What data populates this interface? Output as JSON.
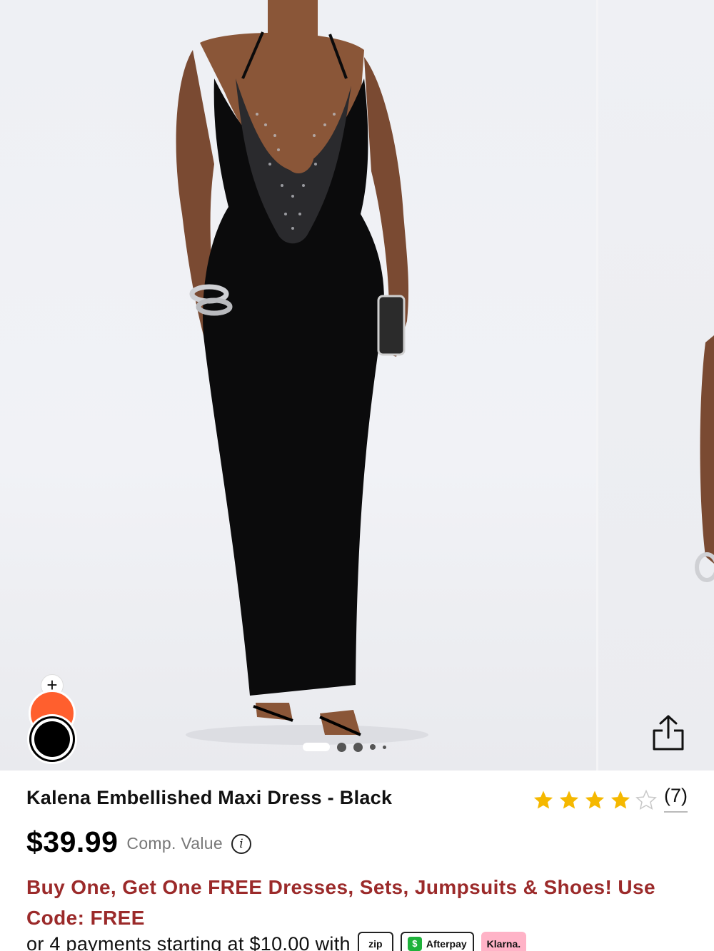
{
  "gallery": {
    "slides_total": 5,
    "active_slide": 1,
    "swatch_add_label": "+"
  },
  "product": {
    "title": "Kalena Embellished Maxi Dress - Black",
    "rating": 4,
    "rating_max": 5,
    "review_count": "(7)",
    "price": "$39.99",
    "comp_value_label": "Comp. Value",
    "info_icon_glyph": "i",
    "promo": "Buy One, Get One FREE Dresses, Sets, Jumpsuits & Shoes! Use Code: FREE",
    "payments_text": "or 4 payments starting at $10.00 with",
    "payment_badges": {
      "zip": "zip",
      "afterpay": "Afterpay",
      "klarna": "Klarna."
    }
  },
  "colors": {
    "promo_text": "#9b2a2a",
    "star_fill": "#f5b800",
    "swatch_orange": "#ff5f2e",
    "swatch_black": "#000000",
    "afterpay_green": "#1fb23b",
    "klarna_pink": "#ffb3c7"
  },
  "icons": {
    "share": "share-icon",
    "info": "info-icon",
    "star": "star-icon"
  }
}
